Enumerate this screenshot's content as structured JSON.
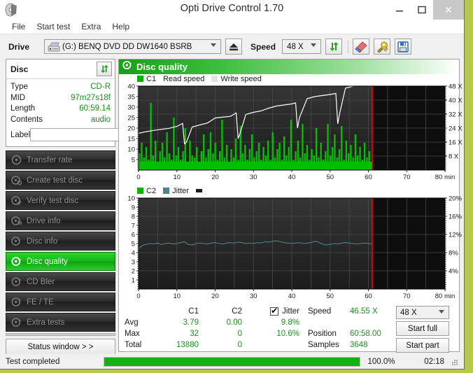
{
  "window": {
    "title": "Opti Drive Control 1.70",
    "icon": "disc-icon",
    "minimize": "–",
    "maximize": "□",
    "close": "✕"
  },
  "menu": {
    "items": [
      "File",
      "Start test",
      "Extra",
      "Help"
    ]
  },
  "toolbar": {
    "drive_label": "Drive",
    "drive_value": "(G:)   BENQ DVD DD DW1640 BSRB",
    "eject_icon": "eject-icon",
    "speed_label": "Speed",
    "speed_value": "48 X",
    "refresh_icon": "refresh-icon",
    "eraser_icon": "eraser-icon",
    "tools_icon": "tools-icon",
    "save_icon": "save-icon"
  },
  "disc": {
    "header": "Disc",
    "refresh_icon": "refresh-icon",
    "rows": [
      {
        "key": "Type",
        "value": "CD-R"
      },
      {
        "key": "MID",
        "value": "97m27s18f"
      },
      {
        "key": "Length",
        "value": "60:59.14"
      },
      {
        "key": "Contents",
        "value": "audio"
      }
    ],
    "label_key": "Label",
    "label_value": "",
    "label_placeholder": "",
    "disc_icon": "compact-disc-icon"
  },
  "nav": {
    "items": [
      {
        "label": "Transfer rate",
        "icon": "disc-icon",
        "active": false
      },
      {
        "label": "Create test disc",
        "icon": "disc-write-icon",
        "active": false
      },
      {
        "label": "Verify test disc",
        "icon": "disc-check-icon",
        "active": false
      },
      {
        "label": "Drive info",
        "icon": "disc-info-icon",
        "active": false
      },
      {
        "label": "Disc info",
        "icon": "disc-info-icon",
        "active": false
      },
      {
        "label": "Disc quality",
        "icon": "disc-quality-icon",
        "active": true
      },
      {
        "label": "CD Bler",
        "icon": "disc-icon",
        "active": false
      },
      {
        "label": "FE / TE",
        "icon": "disc-icon",
        "active": false
      },
      {
        "label": "Extra tests",
        "icon": "disc-icon",
        "active": false
      }
    ],
    "status_window_button": "Status window > >"
  },
  "quality": {
    "header": "Disc quality",
    "header_icon": "disc-quality-icon"
  },
  "chart_data": [
    {
      "type": "line",
      "name": "c1-chart",
      "title": "",
      "legend": [
        {
          "label": "C1",
          "color": "#00b000",
          "swatch": true
        },
        {
          "label": "Read speed",
          "color": "#ffffff",
          "swatch": false
        },
        {
          "label": "Write speed",
          "color": "#dcdcdc",
          "swatch": true
        }
      ],
      "legend_position": "top-left",
      "grid": true,
      "xlabel": "min",
      "ylabel": "",
      "xlim": [
        0,
        80
      ],
      "xticks": [
        0,
        10,
        20,
        30,
        40,
        50,
        60,
        70,
        80
      ],
      "xtick_labels": [
        "0",
        "10",
        "20",
        "30",
        "40",
        "50",
        "60",
        "70",
        "80 min"
      ],
      "ylim": [
        0,
        40
      ],
      "yticks": [
        5,
        10,
        15,
        20,
        25,
        30,
        35,
        40
      ],
      "y2lim": [
        0,
        48
      ],
      "y2ticks": [
        8,
        16,
        24,
        32,
        40,
        48
      ],
      "y2tick_labels": [
        "8 X",
        "16 X",
        "24 X",
        "32 X",
        "40 X",
        "48 X"
      ],
      "data_end_x": 61,
      "marker_line_x": 61,
      "marker_line_color": "#ff0000",
      "series": [
        {
          "name": "C1",
          "color": "#00c000",
          "kind": "bars",
          "x": [
            0,
            0.6,
            1.2,
            1.8,
            2.4,
            3,
            3.6,
            4.2,
            4.8,
            5.4,
            6,
            6.6,
            7.2,
            7.8,
            8.4,
            9,
            9.6,
            10.2,
            10.8,
            11.4,
            12,
            12.6,
            13.2,
            13.8,
            14.4,
            15,
            15.6,
            16.2,
            16.8,
            17.4,
            18,
            18.6,
            19.2,
            19.8,
            20.4,
            21,
            21.6,
            22.2,
            22.8,
            23.4,
            24,
            24.6,
            25.2,
            25.8,
            26.4,
            27,
            27.6,
            28.2,
            28.8,
            29.4,
            30,
            30.6,
            31.2,
            31.8,
            32.4,
            33,
            33.6,
            34.2,
            34.8,
            35.4,
            36,
            36.6,
            37.2,
            37.8,
            38.4,
            39,
            39.6,
            40.2,
            40.8,
            41.4,
            42,
            42.6,
            43.2,
            43.8,
            44.4,
            45,
            45.6,
            46.2,
            46.8,
            47.4,
            48,
            48.6,
            49.2,
            49.8,
            50.4,
            51,
            51.6,
            52.2,
            52.8,
            53.4,
            54,
            54.6,
            55.2,
            55.8,
            56.4,
            57,
            57.6,
            58.2,
            58.8,
            59.4,
            60,
            60.6
          ],
          "values": [
            8,
            13,
            6,
            11,
            5,
            32,
            7,
            14,
            4,
            9,
            13,
            6,
            18,
            8,
            5,
            25,
            7,
            11,
            5,
            9,
            20,
            4,
            14,
            7,
            6,
            11,
            4,
            9,
            17,
            6,
            10,
            18,
            8,
            13,
            5,
            9,
            24,
            6,
            12,
            4,
            10,
            6,
            15,
            5,
            21,
            8,
            12,
            5,
            10,
            17,
            6,
            9,
            13,
            5,
            11,
            7,
            14,
            5,
            18,
            6,
            10,
            13,
            5,
            16,
            7,
            11,
            24,
            5,
            9,
            14,
            6,
            22,
            8,
            12,
            5,
            10,
            7,
            20,
            6,
            13,
            5,
            9,
            22,
            7,
            11,
            17,
            6,
            10,
            21,
            5,
            14,
            8,
            12,
            6,
            17,
            7,
            11,
            5,
            13,
            6,
            9,
            4
          ]
        },
        {
          "name": "Read speed",
          "color": "#ffffff",
          "kind": "line",
          "x": [
            0,
            2,
            4,
            6,
            8,
            10,
            11.5,
            12,
            12.5,
            14,
            16,
            18,
            20,
            22,
            24,
            25.5,
            26,
            26.5,
            28,
            30,
            32,
            34,
            36,
            38,
            40,
            41,
            41.5,
            42,
            44,
            46,
            48,
            50,
            51.5,
            52,
            52.5,
            54,
            56,
            58,
            60,
            61
          ],
          "values": [
            17.5,
            18.3,
            18.9,
            19.4,
            19.9,
            20.8,
            22.2,
            12.5,
            13.2,
            20.5,
            21.5,
            22.4,
            24.8,
            25.2,
            25.6,
            27.2,
            15,
            17.5,
            26.5,
            27.5,
            28.2,
            29.5,
            30.5,
            31,
            31.5,
            32,
            20,
            25,
            34,
            35,
            35.5,
            36,
            36.5,
            22,
            27,
            39,
            40,
            40.5,
            41,
            41
          ]
        }
      ]
    },
    {
      "type": "line",
      "name": "c2-jitter-chart",
      "title": "",
      "legend": [
        {
          "label": "C2",
          "color": "#00b000",
          "swatch": true
        },
        {
          "label": "Jitter",
          "color": "#4d7f80",
          "swatch": true
        }
      ],
      "legend_position": "top-left",
      "grid": true,
      "xlabel": "min",
      "ylabel": "",
      "xlim": [
        0,
        80
      ],
      "xticks": [
        0,
        10,
        20,
        30,
        40,
        50,
        60,
        70,
        80
      ],
      "xtick_labels": [
        "0",
        "10",
        "20",
        "30",
        "40",
        "50",
        "60",
        "70",
        "80 min"
      ],
      "ylim": [
        0,
        10
      ],
      "yticks": [
        1,
        2,
        3,
        4,
        5,
        6,
        7,
        8,
        9,
        10
      ],
      "y2lim": [
        0,
        20
      ],
      "y2ticks": [
        4,
        8,
        12,
        16,
        20
      ],
      "y2tick_labels": [
        "4%",
        "8%",
        "12%",
        "16%",
        "20%"
      ],
      "data_end_x": 61,
      "marker_line_x": 61,
      "marker_line_color": "#ff0000",
      "series": [
        {
          "name": "C2",
          "color": "#00c000",
          "kind": "bars",
          "x": [],
          "values": []
        },
        {
          "name": "Jitter",
          "color": "#4d8486",
          "kind": "line",
          "x": [
            0,
            1,
            2,
            3,
            4,
            5,
            6,
            7,
            8,
            9,
            10,
            11,
            12,
            13,
            14,
            15,
            16,
            17,
            18,
            19,
            20,
            21,
            22,
            23,
            24,
            25,
            26,
            27,
            28,
            29,
            30,
            31,
            32,
            33,
            34,
            35,
            36,
            37,
            38,
            39,
            40,
            41,
            42,
            43,
            44,
            45,
            46,
            47,
            48,
            49,
            50,
            51,
            52,
            53,
            54,
            55,
            56,
            57,
            58,
            59,
            60,
            61
          ],
          "values": [
            4.4,
            4.8,
            4.9,
            5.0,
            4.95,
            5.05,
            4.9,
            5.0,
            5.05,
            4.95,
            5.0,
            5.1,
            5.2,
            4.9,
            4.85,
            5.0,
            5.05,
            5.0,
            4.95,
            5.05,
            5.1,
            5.0,
            4.95,
            5.05,
            5.1,
            5.05,
            5.15,
            5.1,
            5.0,
            5.05,
            5.0,
            5.1,
            5.05,
            5.2,
            5.15,
            5.25,
            5.3,
            5.2,
            5.1,
            5.05,
            5.0,
            5.05,
            5.1,
            5.0,
            5.05,
            5.1,
            5.25,
            5.15,
            4.95,
            4.85,
            4.9,
            5.0,
            4.95,
            5.05,
            5.1,
            5.05,
            5.0,
            4.95,
            5.0,
            5.05,
            5.0,
            4.95
          ]
        }
      ]
    }
  ],
  "stats": {
    "headers": {
      "c1": "C1",
      "c2": "C2",
      "jitter": "Jitter"
    },
    "jitter_checked": true,
    "rows": [
      {
        "label": "Avg",
        "c1": "3.79",
        "c2": "0.00",
        "jitter": "9.8%"
      },
      {
        "label": "Max",
        "c1": "32",
        "c2": "0",
        "jitter": "10.6%"
      },
      {
        "label": "Total",
        "c1": "13880",
        "c2": "0",
        "jitter": ""
      }
    ],
    "right": [
      {
        "key": "Speed",
        "value": "46.55 X"
      },
      {
        "key": "Position",
        "value": "60:58.00"
      },
      {
        "key": "Samples",
        "value": "3648"
      }
    ],
    "speed_select": "48 X",
    "start_full": "Start full",
    "start_part": "Start part"
  },
  "statusbar": {
    "message": "Test completed",
    "progress_percent": 100,
    "progress_text": "100.0%",
    "elapsed": "02:18"
  },
  "colors": {
    "accent_green": "#12b212",
    "value_green": "#1e8e1e",
    "marker_red": "#ff0000",
    "chart_bg": "#262626",
    "jitter_teal": "#4d8486"
  }
}
